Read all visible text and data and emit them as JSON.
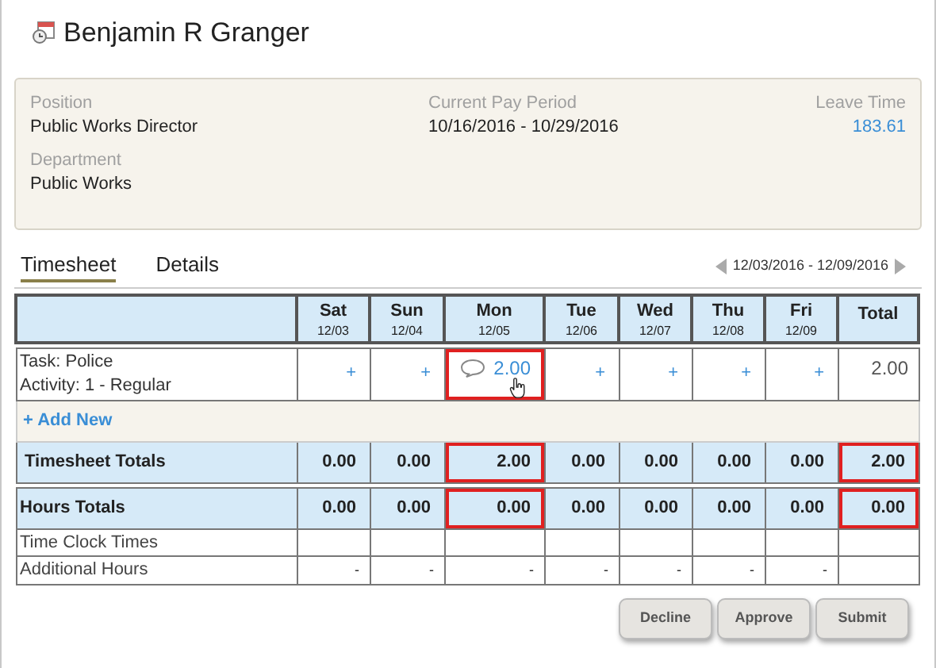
{
  "title": "Benjamin R Granger",
  "info": [
    {
      "label": "Position",
      "value": "Public Works Director",
      "kind": "text"
    },
    {
      "label": "Current Pay Period",
      "value": "10/16/2016 - 10/29/2016",
      "kind": "text"
    },
    {
      "label": "Leave Time",
      "value": "183.61",
      "kind": "link"
    },
    {
      "label": "Department",
      "value": "Public Works",
      "kind": "text"
    }
  ],
  "tabs": [
    {
      "label": "Timesheet",
      "selected": true
    },
    {
      "label": "Details",
      "selected": false
    }
  ],
  "period": "12/03/2016 - 12/09/2016",
  "columns": [
    {
      "day": "Sat",
      "date": "12/03"
    },
    {
      "day": "Sun",
      "date": "12/04"
    },
    {
      "day": "Mon",
      "date": "12/05"
    },
    {
      "day": "Tue",
      "date": "12/06"
    },
    {
      "day": "Wed",
      "date": "12/07"
    },
    {
      "day": "Thu",
      "date": "12/08"
    },
    {
      "day": "Fri",
      "date": "12/09"
    }
  ],
  "total_heading": "Total",
  "task": {
    "lines": [
      "Task: Police",
      "Activity: 1 - Regular"
    ],
    "cells": [
      {
        "value": "+",
        "kind": "add",
        "highlighted": false
      },
      {
        "value": "+",
        "kind": "add",
        "highlighted": false
      },
      {
        "value": "2.00",
        "kind": "entry",
        "highlighted": true
      },
      {
        "value": "+",
        "kind": "add",
        "highlighted": false
      },
      {
        "value": "+",
        "kind": "add",
        "highlighted": false
      },
      {
        "value": "+",
        "kind": "add",
        "highlighted": false
      },
      {
        "value": "+",
        "kind": "add",
        "highlighted": false
      }
    ],
    "total": "2.00"
  },
  "add_new": "+ Add New",
  "totals": [
    {
      "label": "Timesheet Totals",
      "cells": [
        {
          "value": "0.00",
          "highlighted": false
        },
        {
          "value": "0.00",
          "highlighted": false
        },
        {
          "value": "2.00",
          "highlighted": true
        },
        {
          "value": "0.00",
          "highlighted": false
        },
        {
          "value": "0.00",
          "highlighted": false
        },
        {
          "value": "0.00",
          "highlighted": false
        },
        {
          "value": "0.00",
          "highlighted": false
        },
        {
          "value": "2.00",
          "highlighted": true
        }
      ]
    },
    {
      "label": "Hours Totals",
      "cells": [
        {
          "value": "0.00",
          "highlighted": false
        },
        {
          "value": "0.00",
          "highlighted": false
        },
        {
          "value": "0.00",
          "highlighted": true
        },
        {
          "value": "0.00",
          "highlighted": false
        },
        {
          "value": "0.00",
          "highlighted": false
        },
        {
          "value": "0.00",
          "highlighted": false
        },
        {
          "value": "0.00",
          "highlighted": false
        },
        {
          "value": "0.00",
          "highlighted": true
        }
      ]
    }
  ],
  "extra_rows": [
    {
      "label": "Time Clock Times",
      "cells": []
    },
    {
      "label": "Additional Hours",
      "cells": [
        "-",
        "-",
        "-",
        "-",
        "-",
        "-",
        "-"
      ]
    }
  ],
  "buttons": [
    "Decline",
    "Approve",
    "Submit"
  ]
}
